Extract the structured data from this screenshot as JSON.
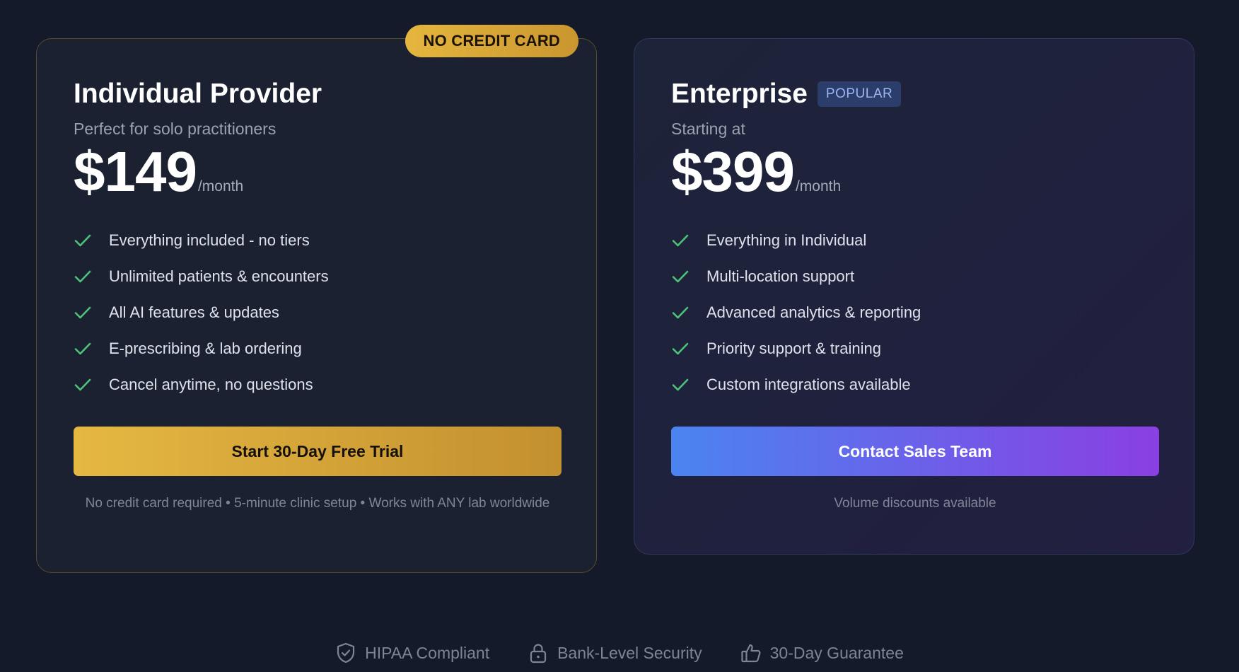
{
  "individual": {
    "ribbon": "NO CREDIT CARD",
    "title": "Individual Provider",
    "subtitle": "Perfect for solo practitioners",
    "price": "$149",
    "period": "/month",
    "features": [
      "Everything included - no tiers",
      "Unlimited patients & encounters",
      "All AI features & updates",
      "E-prescribing & lab ordering",
      "Cancel anytime, no questions"
    ],
    "cta": "Start 30-Day Free Trial",
    "fine_print": "No credit card required • 5-minute clinic setup • Works with ANY lab worldwide"
  },
  "enterprise": {
    "title": "Enterprise",
    "badge": "POPULAR",
    "subtitle": "Starting at",
    "price": "$399",
    "period": "/month",
    "features": [
      "Everything in Individual",
      "Multi-location support",
      "Advanced analytics & reporting",
      "Priority support & training",
      "Custom integrations available"
    ],
    "cta": "Contact Sales Team",
    "fine_print": "Volume discounts available"
  },
  "trust": [
    {
      "icon": "shield-check-icon",
      "label": "HIPAA Compliant"
    },
    {
      "icon": "lock-icon",
      "label": "Bank-Level Security"
    },
    {
      "icon": "thumbs-up-icon",
      "label": "30-Day Guarantee"
    }
  ],
  "colors": {
    "background": "#141a2a",
    "gold": "#e5b842",
    "check": "#4ec27a",
    "blue": "#4b84f1",
    "purple": "#8a3fe2"
  }
}
